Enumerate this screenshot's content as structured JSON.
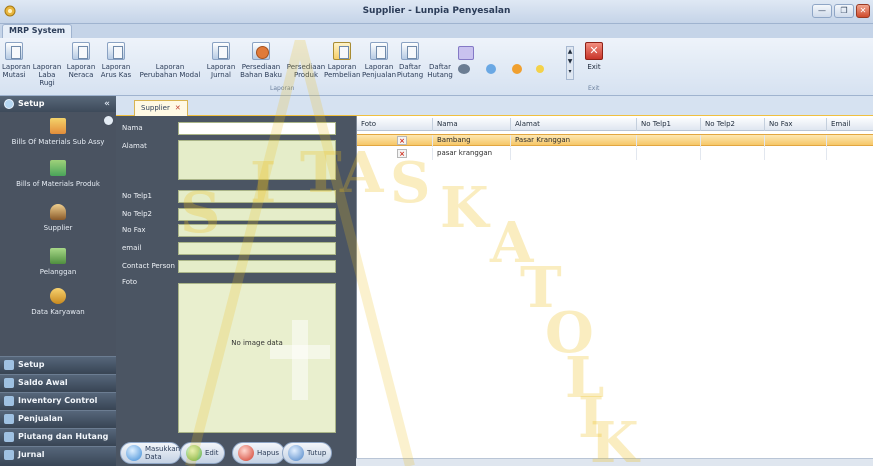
{
  "window": {
    "title": "Supplier - Lunpia Penyesalan",
    "buttons": {
      "minimize": "—",
      "maximize": "❐",
      "close": "✕"
    }
  },
  "ribbon": {
    "tab": "MRP System",
    "buttons": [
      {
        "line1": "Laporan",
        "line2": "Mutasi"
      },
      {
        "line1": "Laporan",
        "line2": "Laba Rugi"
      },
      {
        "line1": "Laporan",
        "line2": "Neraca"
      },
      {
        "line1": "Laporan",
        "line2": "Arus Kas"
      },
      {
        "line1": "Laporan",
        "line2": "Perubahan Modal"
      },
      {
        "line1": "Laporan",
        "line2": "Jurnal"
      },
      {
        "line1": "Persediaan",
        "line2": "Bahan Baku"
      },
      {
        "line1": "Persediaan",
        "line2": "Produk"
      },
      {
        "line1": "Laporan",
        "line2": "Pembelian"
      },
      {
        "line1": "Laporan",
        "line2": "Penjualan"
      },
      {
        "line1": "Daftar",
        "line2": "Piutang"
      },
      {
        "line1": "Daftar",
        "line2": "Hutang"
      }
    ],
    "group_label": "Laporan",
    "exit_label": "Exit",
    "exit_group_label": "Exit"
  },
  "sidebar": {
    "header": "Setup",
    "collapse": "«",
    "items": [
      {
        "label": "Bills Of Materials Sub Assy"
      },
      {
        "label": "Bills of Materials Produk"
      },
      {
        "label": "Supplier"
      },
      {
        "label": "Pelanggan"
      },
      {
        "label": "Data Karyawan"
      }
    ],
    "nav": [
      "Setup",
      "Saldo Awal",
      "Inventory Control",
      "Penjualan",
      "Piutang dan Hutang",
      "Jurnal"
    ]
  },
  "doc_tab": {
    "label": "Supplier",
    "close": "✕"
  },
  "form": {
    "labels": {
      "nama": "Nama",
      "alamat": "Alamat",
      "telp1": "No Telp1",
      "telp2": "No Telp2",
      "fax": "No Fax",
      "email": "email",
      "contact": "Contact Person",
      "foto": "Foto"
    },
    "photo_placeholder": "No image data",
    "buttons": {
      "masukkan": "Masukkan Data",
      "edit": "Edit",
      "hapus": "Hapus",
      "tutup": "Tutup"
    }
  },
  "grid": {
    "columns": [
      "Foto",
      "Nama",
      "Alamat",
      "No Telp1",
      "No Telp2",
      "No Fax",
      "Email"
    ],
    "rows": [
      {
        "nama": "Bambang",
        "alamat": "Pasar Kranggan",
        "selected": true
      },
      {
        "nama": "pasar kranggan",
        "alamat": "",
        "selected": false
      }
    ]
  },
  "watermark": [
    "S",
    "I",
    "T",
    "A",
    "S",
    "K",
    "A",
    "T",
    "O",
    "L",
    "I",
    "K"
  ],
  "colors": {
    "accent": "#f0c040",
    "sidebar": "#3a4655",
    "form": "#4b5563",
    "selected_row": "#f6c768"
  }
}
